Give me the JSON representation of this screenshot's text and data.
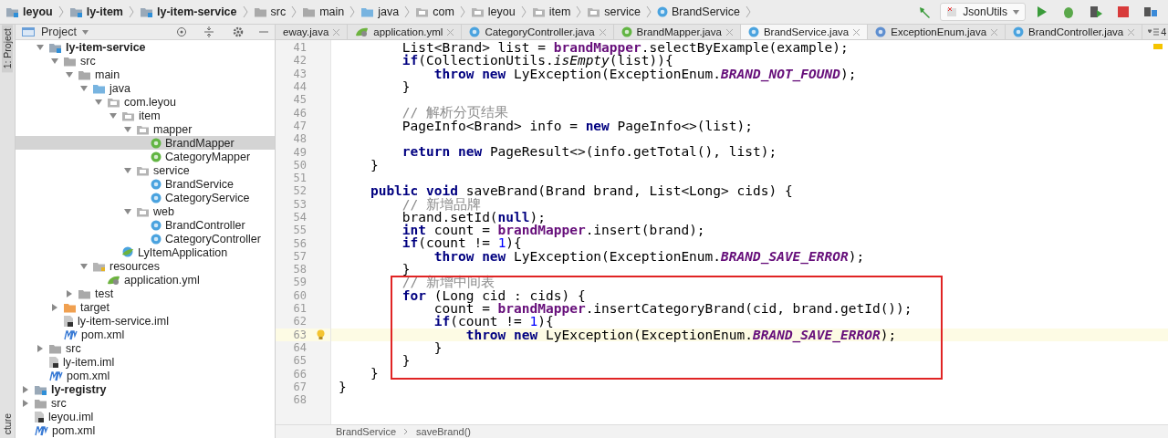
{
  "breadcrumbs": [
    {
      "label": "leyou",
      "kind": "module"
    },
    {
      "label": "ly-item",
      "kind": "module"
    },
    {
      "label": "ly-item-service",
      "kind": "module"
    },
    {
      "label": "src",
      "kind": "folder"
    },
    {
      "label": "main",
      "kind": "folder"
    },
    {
      "label": "java",
      "kind": "source-folder"
    },
    {
      "label": "com",
      "kind": "package"
    },
    {
      "label": "leyou",
      "kind": "package"
    },
    {
      "label": "item",
      "kind": "package"
    },
    {
      "label": "service",
      "kind": "package"
    },
    {
      "label": "BrandService",
      "kind": "class"
    }
  ],
  "run_toolbar": {
    "configuration": "JsonUtils"
  },
  "tool_strip": {
    "top": "1: Project",
    "bottom": "cture"
  },
  "project_panel": {
    "title": "Project"
  },
  "project_tree": [
    {
      "children": [
        {
          "children": [
            {
              "label": "ly-item-service",
              "kind": "module",
              "expanded": true,
              "selected": false,
              "children": [
                {
                  "label": "src",
                  "kind": "folder",
                  "expanded": true,
                  "selected": false,
                  "children": [
                    {
                      "label": "main",
                      "kind": "folder",
                      "expanded": true,
                      "selected": false,
                      "children": [
                        {
                          "label": "java",
                          "kind": "source-folder",
                          "expanded": true,
                          "selected": false,
                          "children": [
                            {
                              "label": "com.leyou",
                              "kind": "package",
                              "expanded": true,
                              "selected": false,
                              "children": [
                                {
                                  "label": "item",
                                  "kind": "package",
                                  "expanded": true,
                                  "selected": false,
                                  "children": [
                                    {
                                      "label": "mapper",
                                      "kind": "package",
                                      "expanded": true,
                                      "selected": false,
                                      "children": [
                                        {
                                          "label": "BrandMapper",
                                          "kind": "interface",
                                          "selected": true
                                        },
                                        {
                                          "label": "CategoryMapper",
                                          "kind": "interface",
                                          "selected": false
                                        }
                                      ]
                                    },
                                    {
                                      "label": "service",
                                      "kind": "package",
                                      "expanded": true,
                                      "selected": false,
                                      "children": [
                                        {
                                          "label": "BrandService",
                                          "kind": "class",
                                          "selected": false
                                        },
                                        {
                                          "label": "CategoryService",
                                          "kind": "class",
                                          "selected": false
                                        }
                                      ]
                                    },
                                    {
                                      "label": "web",
                                      "kind": "package",
                                      "expanded": true,
                                      "selected": false,
                                      "children": [
                                        {
                                          "label": "BrandController",
                                          "kind": "class",
                                          "selected": false
                                        },
                                        {
                                          "label": "CategoryController",
                                          "kind": "class",
                                          "selected": false
                                        }
                                      ]
                                    }
                                  ]
                                },
                                {
                                  "label": "LyItemApplication",
                                  "kind": "application",
                                  "selected": false
                                }
                              ]
                            }
                          ]
                        },
                        {
                          "label": "resources",
                          "kind": "resources-folder",
                          "expanded": true,
                          "selected": false,
                          "children": [
                            {
                              "label": "application.yml",
                              "kind": "yaml",
                              "selected": false
                            }
                          ]
                        }
                      ]
                    },
                    {
                      "label": "test",
                      "kind": "folder",
                      "expanded": false,
                      "selected": false
                    }
                  ]
                },
                {
                  "label": "target",
                  "kind": "excluded-folder",
                  "expanded": false,
                  "selected": false
                },
                {
                  "label": "ly-item-service.iml",
                  "kind": "iml",
                  "selected": false
                },
                {
                  "label": "pom.xml",
                  "kind": "pom",
                  "selected": false
                }
              ]
            },
            {
              "label": "src",
              "kind": "folder",
              "expanded": false,
              "selected": false
            },
            {
              "label": "ly-item.iml",
              "kind": "iml",
              "selected": false
            },
            {
              "label": "pom.xml",
              "kind": "pom",
              "selected": false
            }
          ]
        },
        {
          "label": "ly-registry",
          "kind": "module",
          "expanded": false,
          "selected": false
        },
        {
          "label": "src",
          "kind": "folder",
          "expanded": false,
          "selected": false
        },
        {
          "label": "leyou.iml",
          "kind": "iml",
          "selected": false
        },
        {
          "label": "pom.xml",
          "kind": "pom",
          "selected": false
        }
      ]
    }
  ],
  "editor_tabs": [
    {
      "label": "eway.java",
      "kind": "cut",
      "selected": false
    },
    {
      "label": "application.yml",
      "kind": "yaml",
      "selected": false
    },
    {
      "label": "CategoryController.java",
      "kind": "class",
      "selected": false
    },
    {
      "label": "BrandMapper.java",
      "kind": "interface",
      "selected": false
    },
    {
      "label": "BrandService.java",
      "kind": "class",
      "selected": true
    },
    {
      "label": "ExceptionEnum.java",
      "kind": "enum",
      "selected": false
    },
    {
      "label": "BrandController.java",
      "kind": "class",
      "selected": false
    }
  ],
  "tab_overflow_count": "4",
  "code_blocks": [
    {
      "boxed": false,
      "lines": [
        {
          "number": "41",
          "current": false,
          "tokens": [
            {
              "kind": "plain",
              "text": "        List<Brand> list = "
            },
            {
              "kind": "field",
              "text": "brandMapper"
            },
            {
              "kind": "plain",
              "text": ".selectByExample(example);"
            }
          ]
        },
        {
          "number": "42",
          "current": false,
          "tokens": [
            {
              "kind": "keyword",
              "text": "        if"
            },
            {
              "kind": "plain",
              "text": "(CollectionUtils."
            },
            {
              "kind": "static",
              "text": "isEmpty"
            },
            {
              "kind": "plain",
              "text": "(list)){"
            }
          ]
        },
        {
          "number": "43",
          "current": false,
          "tokens": [
            {
              "kind": "keyword",
              "text": "            throw new "
            },
            {
              "kind": "plain",
              "text": "LyException(ExceptionEnum."
            },
            {
              "kind": "constant",
              "text": "BRAND_NOT_FOUND"
            },
            {
              "kind": "plain",
              "text": ");"
            }
          ]
        },
        {
          "number": "44",
          "current": false,
          "tokens": [
            {
              "kind": "plain",
              "text": "        }"
            }
          ]
        },
        {
          "number": "45",
          "current": false
        },
        {
          "number": "46",
          "current": false,
          "tokens": [
            {
              "kind": "comment",
              "text": "        // 解析分页结果"
            }
          ]
        },
        {
          "number": "47",
          "current": false,
          "tokens": [
            {
              "kind": "plain",
              "text": "        PageInfo<Brand> info = "
            },
            {
              "kind": "keyword",
              "text": "new "
            },
            {
              "kind": "plain",
              "text": "PageInfo<>(list);"
            }
          ]
        },
        {
          "number": "48",
          "current": false
        },
        {
          "number": "49",
          "current": false,
          "tokens": [
            {
              "kind": "keyword",
              "text": "        return new "
            },
            {
              "kind": "plain",
              "text": "PageResult<>(info.getTotal(), list);"
            }
          ]
        },
        {
          "number": "50",
          "current": false,
          "tokens": [
            {
              "kind": "plain",
              "text": "    }"
            }
          ]
        },
        {
          "number": "51",
          "current": false
        },
        {
          "number": "52",
          "current": false,
          "tokens": [
            {
              "kind": "keyword",
              "text": "    public void "
            },
            {
              "kind": "plain",
              "text": "saveBrand(Brand brand, List<Long> cids) {"
            }
          ]
        },
        {
          "number": "53",
          "current": false,
          "tokens": [
            {
              "kind": "comment",
              "text": "        // 新增品牌"
            }
          ]
        },
        {
          "number": "54",
          "current": false,
          "tokens": [
            {
              "kind": "plain",
              "text": "        brand.setId("
            },
            {
              "kind": "keyword",
              "text": "null"
            },
            {
              "kind": "plain",
              "text": ");"
            }
          ]
        },
        {
          "number": "55",
          "current": false,
          "tokens": [
            {
              "kind": "keyword",
              "text": "        int "
            },
            {
              "kind": "plain",
              "text": "count = "
            },
            {
              "kind": "field",
              "text": "brandMapper"
            },
            {
              "kind": "plain",
              "text": ".insert(brand);"
            }
          ]
        },
        {
          "number": "56",
          "current": false,
          "tokens": [
            {
              "kind": "keyword",
              "text": "        if"
            },
            {
              "kind": "plain",
              "text": "(count != "
            },
            {
              "kind": "number",
              "text": "1"
            },
            {
              "kind": "plain",
              "text": "){"
            }
          ]
        },
        {
          "number": "57",
          "current": false,
          "tokens": [
            {
              "kind": "keyword",
              "text": "            throw new "
            },
            {
              "kind": "plain",
              "text": "LyException(ExceptionEnum."
            },
            {
              "kind": "constant",
              "text": "BRAND_SAVE_ERROR"
            },
            {
              "kind": "plain",
              "text": ");"
            }
          ]
        },
        {
          "number": "58",
          "current": false,
          "tokens": [
            {
              "kind": "plain",
              "text": "        }"
            }
          ]
        }
      ]
    },
    {
      "boxed": true,
      "lines": [
        {
          "number": "59",
          "current": false,
          "tokens": [
            {
              "kind": "comment",
              "text": "        // 新增中间表"
            }
          ]
        },
        {
          "number": "60",
          "current": false,
          "tokens": [
            {
              "kind": "keyword",
              "text": "        for "
            },
            {
              "kind": "plain",
              "text": "(Long cid : cids) {"
            }
          ]
        },
        {
          "number": "61",
          "current": false,
          "tokens": [
            {
              "kind": "plain",
              "text": "            count = "
            },
            {
              "kind": "field",
              "text": "brandMapper"
            },
            {
              "kind": "plain",
              "text": ".insertCategoryBrand(cid, brand.getId());"
            }
          ]
        },
        {
          "number": "62",
          "current": false,
          "tokens": [
            {
              "kind": "keyword",
              "text": "            if"
            },
            {
              "kind": "plain",
              "text": "(count != "
            },
            {
              "kind": "number",
              "text": "1"
            },
            {
              "kind": "plain",
              "text": "){"
            }
          ]
        },
        {
          "number": "63",
          "current": true,
          "tokens": [
            {
              "kind": "keyword",
              "text": "                throw new "
            },
            {
              "kind": "plain",
              "text": "LyException(ExceptionEnum."
            },
            {
              "kind": "constant",
              "text": "BRAND_SAVE_ERROR"
            },
            {
              "kind": "plain",
              "text": ");"
            }
          ]
        },
        {
          "number": "64",
          "current": false,
          "tokens": [
            {
              "kind": "plain",
              "text": "            }"
            }
          ]
        },
        {
          "number": "65",
          "current": false,
          "tokens": [
            {
              "kind": "plain",
              "text": "        }"
            }
          ]
        }
      ]
    },
    {
      "boxed": false,
      "lines": [
        {
          "number": "66",
          "current": false,
          "tokens": [
            {
              "kind": "plain",
              "text": "    }"
            }
          ]
        },
        {
          "number": "67",
          "current": false,
          "tokens": [
            {
              "kind": "plain",
              "text": "}"
            }
          ]
        },
        {
          "number": "68",
          "current": false
        }
      ]
    }
  ],
  "editor_breadcrumbs": [
    "BrandService",
    "saveBrand()"
  ]
}
